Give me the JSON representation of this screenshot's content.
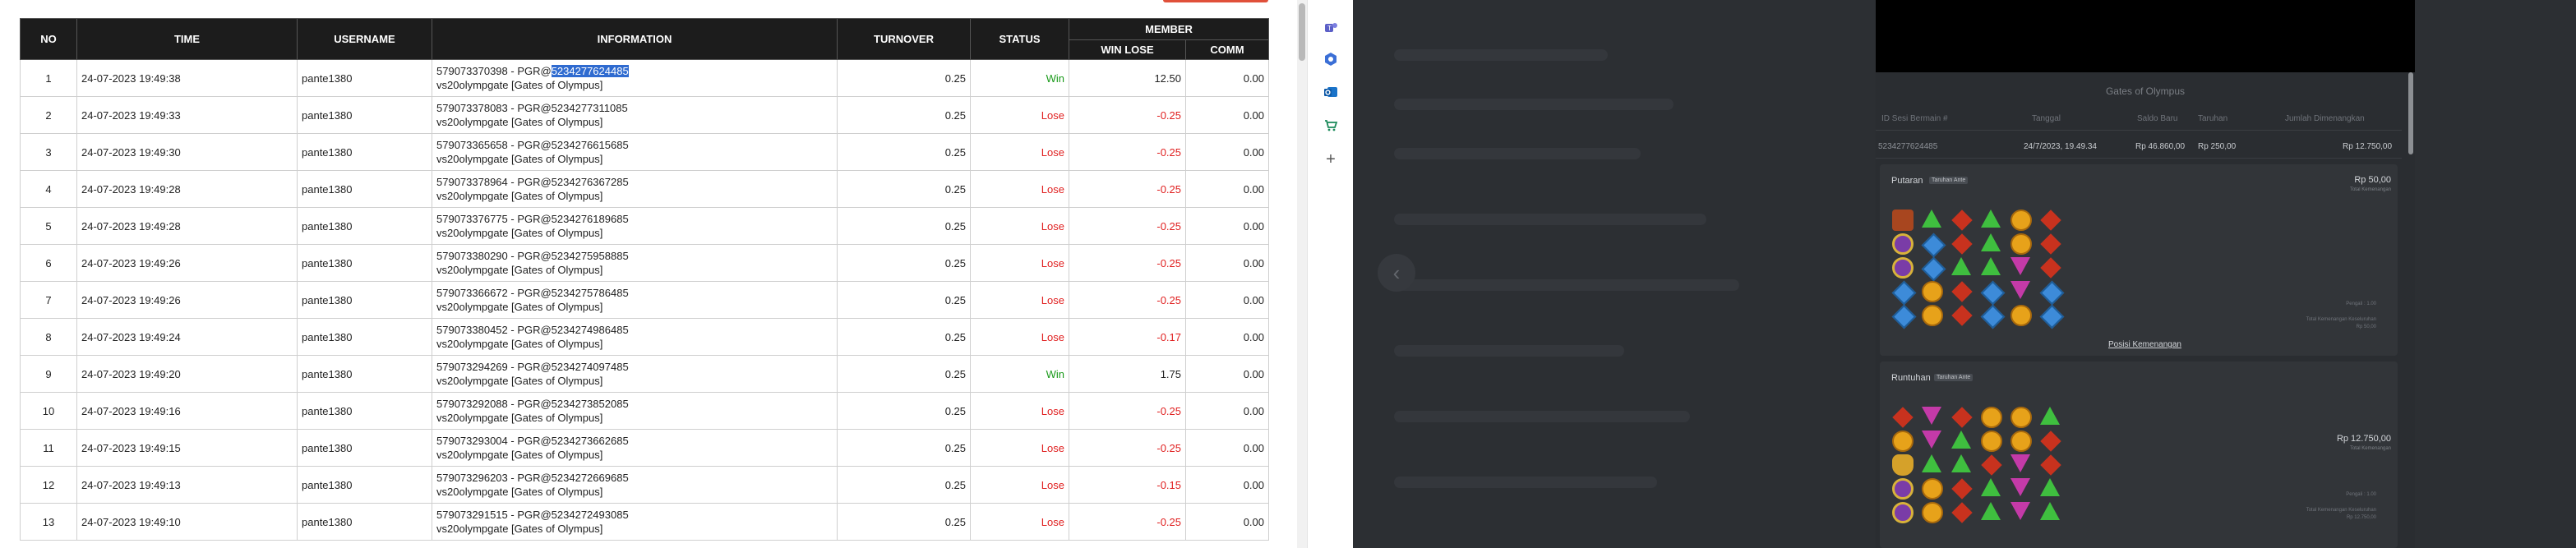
{
  "table": {
    "headers": {
      "no": "NO",
      "time": "TIME",
      "username": "USERNAME",
      "information": "INFORMATION",
      "turnover": "TURNOVER",
      "status": "STATUS",
      "member": "MEMBER",
      "win_lose": "WIN LOSE",
      "comm": "COMM"
    },
    "rows": [
      {
        "no": "1",
        "time": "24-07-2023 19:49:38",
        "username": "pante1380",
        "info_prefix": "579073370398 - PGR@",
        "info_highlight": "5234277624485",
        "info_line2": "vs20olympgate [Gates of Olympus]",
        "turnover": "0.25",
        "status": "Win",
        "win_lose": "12.50",
        "comm": "0.00"
      },
      {
        "no": "2",
        "time": "24-07-2023 19:49:33",
        "username": "pante1380",
        "info_prefix": "579073378083 - PGR@5234277311085",
        "info_highlight": "",
        "info_line2": "vs20olympgate [Gates of Olympus]",
        "turnover": "0.25",
        "status": "Lose",
        "win_lose": "-0.25",
        "comm": "0.00"
      },
      {
        "no": "3",
        "time": "24-07-2023 19:49:30",
        "username": "pante1380",
        "info_prefix": "579073365658 - PGR@5234276615685",
        "info_highlight": "",
        "info_line2": "vs20olympgate [Gates of Olympus]",
        "turnover": "0.25",
        "status": "Lose",
        "win_lose": "-0.25",
        "comm": "0.00"
      },
      {
        "no": "4",
        "time": "24-07-2023 19:49:28",
        "username": "pante1380",
        "info_prefix": "579073378964 - PGR@5234276367285",
        "info_highlight": "",
        "info_line2": "vs20olympgate [Gates of Olympus]",
        "turnover": "0.25",
        "status": "Lose",
        "win_lose": "-0.25",
        "comm": "0.00"
      },
      {
        "no": "5",
        "time": "24-07-2023 19:49:28",
        "username": "pante1380",
        "info_prefix": "579073376775 - PGR@5234276189685",
        "info_highlight": "",
        "info_line2": "vs20olympgate [Gates of Olympus]",
        "turnover": "0.25",
        "status": "Lose",
        "win_lose": "-0.25",
        "comm": "0.00"
      },
      {
        "no": "6",
        "time": "24-07-2023 19:49:26",
        "username": "pante1380",
        "info_prefix": "579073380290 - PGR@5234275958885",
        "info_highlight": "",
        "info_line2": "vs20olympgate [Gates of Olympus]",
        "turnover": "0.25",
        "status": "Lose",
        "win_lose": "-0.25",
        "comm": "0.00"
      },
      {
        "no": "7",
        "time": "24-07-2023 19:49:26",
        "username": "pante1380",
        "info_prefix": "579073366672 - PGR@5234275786485",
        "info_highlight": "",
        "info_line2": "vs20olympgate [Gates of Olympus]",
        "turnover": "0.25",
        "status": "Lose",
        "win_lose": "-0.25",
        "comm": "0.00"
      },
      {
        "no": "8",
        "time": "24-07-2023 19:49:24",
        "username": "pante1380",
        "info_prefix": "579073380452 - PGR@5234274986485",
        "info_highlight": "",
        "info_line2": "vs20olympgate [Gates of Olympus]",
        "turnover": "0.25",
        "status": "Lose",
        "win_lose": "-0.17",
        "comm": "0.00"
      },
      {
        "no": "9",
        "time": "24-07-2023 19:49:20",
        "username": "pante1380",
        "info_prefix": "579073294269 - PGR@5234274097485",
        "info_highlight": "",
        "info_line2": "vs20olympgate [Gates of Olympus]",
        "turnover": "0.25",
        "status": "Win",
        "win_lose": "1.75",
        "comm": "0.00"
      },
      {
        "no": "10",
        "time": "24-07-2023 19:49:16",
        "username": "pante1380",
        "info_prefix": "579073292088 - PGR@5234273852085",
        "info_highlight": "",
        "info_line2": "vs20olympgate [Gates of Olympus]",
        "turnover": "0.25",
        "status": "Lose",
        "win_lose": "-0.25",
        "comm": "0.00"
      },
      {
        "no": "11",
        "time": "24-07-2023 19:49:15",
        "username": "pante1380",
        "info_prefix": "579073293004 - PGR@5234273662685",
        "info_highlight": "",
        "info_line2": "vs20olympgate [Gates of Olympus]",
        "turnover": "0.25",
        "status": "Lose",
        "win_lose": "-0.25",
        "comm": "0.00"
      },
      {
        "no": "12",
        "time": "24-07-2023 19:49:13",
        "username": "pante1380",
        "info_prefix": "579073296203 - PGR@5234272669685",
        "info_highlight": "",
        "info_line2": "vs20olympgate [Gates of Olympus]",
        "turnover": "0.25",
        "status": "Lose",
        "win_lose": "-0.15",
        "comm": "0.00"
      },
      {
        "no": "13",
        "time": "24-07-2023 19:49:10",
        "username": "pante1380",
        "info_prefix": "579073291515 - PGR@5234272493085",
        "info_highlight": "",
        "info_line2": "vs20olympgate [Gates of Olympus]",
        "turnover": "0.25",
        "status": "Lose",
        "win_lose": "-0.25",
        "comm": "0.00"
      }
    ]
  },
  "sidebar": {
    "icons": [
      "teams-icon",
      "extension-icon",
      "outlook-icon",
      "shopping-icon",
      "add-icon"
    ]
  },
  "game_panel": {
    "title": "Gates of Olympus",
    "headers": {
      "id": "ID Sesi Bermain #",
      "date": "Tanggal",
      "balance": "Saldo Baru",
      "bet": "Taruhan",
      "win": "Jumlah Dimenangkan"
    },
    "values": {
      "id": "5234277624485",
      "date": "24/7/2023, 19.49.34",
      "balance": "Rp 46.860,00",
      "bet": "Rp 250,00",
      "win": "Rp 12.750,00"
    },
    "spin_card": {
      "title": "Putaran",
      "badge": "Taruhan Ante",
      "amount": "Rp 50,00",
      "amount_sub": "Total Kemenangan",
      "info_1": "Pengali : 1.00",
      "info_2": "Total Kemenangan Keseluruhan",
      "info_3": "Rp 50,00"
    },
    "win_link": "Posisi Kemenangan",
    "tumble_card": {
      "title": "Runtuhan",
      "badge": "Taruhan Ante",
      "amount": "Rp 12.750,00",
      "amount_sub": "Total Kemenangan",
      "info_1": "Pengali : 1.00",
      "info_2": "Total Kemenangan Keseluruhan",
      "info_3": "Rp 12.750,00"
    }
  },
  "colors": {
    "header_bg": "#1c1c1c",
    "win": "#1a9a1a",
    "lose": "#e02020",
    "highlight": "#2f6bd0",
    "panel_bg": "#2a2d31"
  }
}
